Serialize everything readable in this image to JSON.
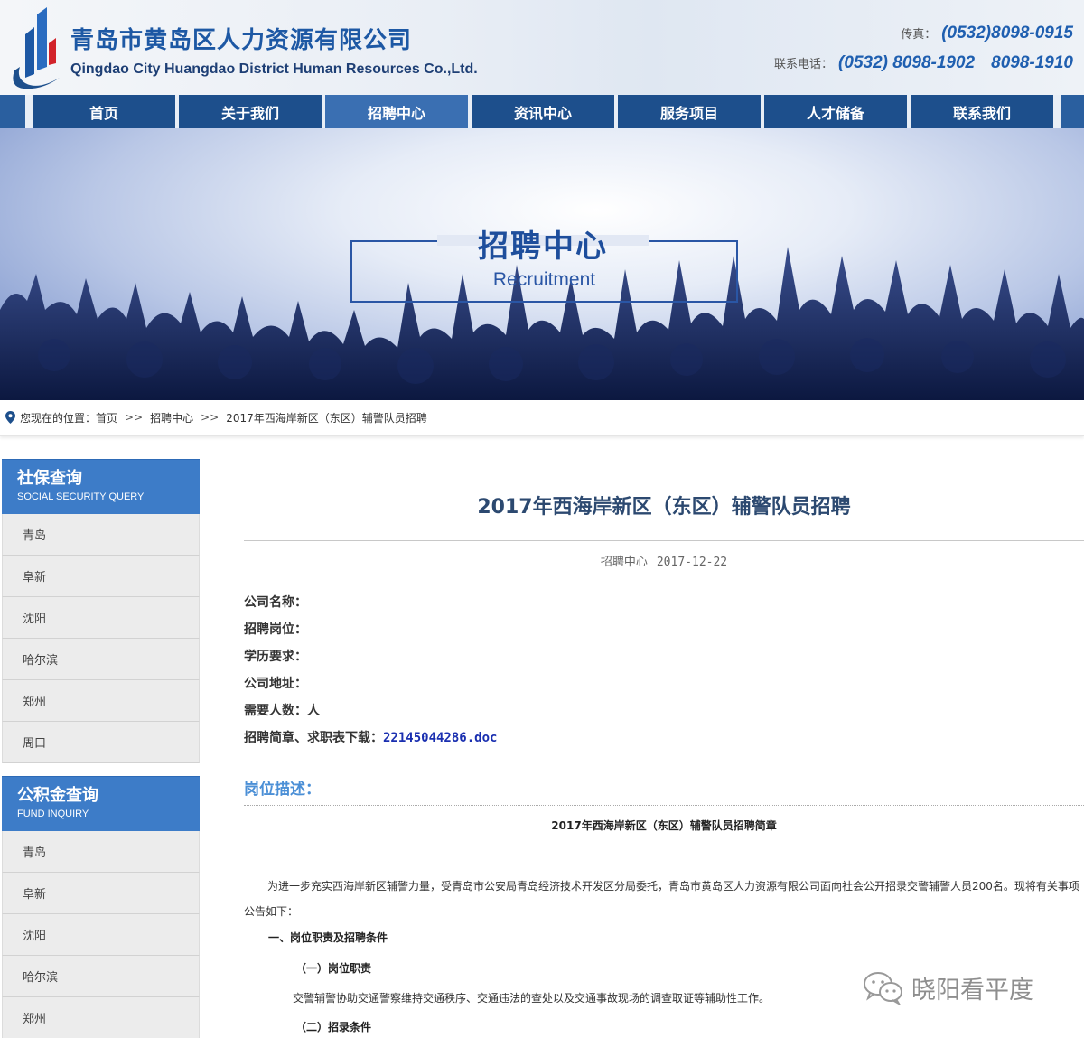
{
  "header": {
    "company_cn": "青岛市黄岛区人力资源有限公司",
    "company_en": "Qingdao City Huangdao District Human Resources Co.,Ltd.",
    "fax_label": "传真：",
    "fax_value": "(0532)8098-0915",
    "tel_label": "联系电话：",
    "tel_value_1": "(0532) 8098-1902",
    "tel_value_2": "8098-1910"
  },
  "nav": {
    "items": [
      {
        "label": "首页"
      },
      {
        "label": "关于我们"
      },
      {
        "label": "招聘中心"
      },
      {
        "label": "资讯中心"
      },
      {
        "label": "服务项目"
      },
      {
        "label": "人才储备"
      },
      {
        "label": "联系我们"
      }
    ],
    "active": "招聘中心"
  },
  "banner": {
    "title": "招聘中心",
    "subtitle": "Recruitment"
  },
  "breadcrumb": {
    "prefix": "您现在的位置：",
    "home": "首页",
    "sep": ">>",
    "section": "招聘中心",
    "current": "2017年西海岸新区（东区）辅警队员招聘"
  },
  "sidebar": {
    "social": {
      "title": "社保查询",
      "title_en": "SOCIAL SECURITY QUERY",
      "items": [
        "青岛",
        "阜新",
        "沈阳",
        "哈尔滨",
        "郑州",
        "周口"
      ]
    },
    "fund": {
      "title": "公积金查询",
      "title_en": "FUND INQUIRY",
      "items": [
        "青岛",
        "阜新",
        "沈阳",
        "哈尔滨",
        "郑州"
      ]
    }
  },
  "article": {
    "title": "2017年西海岸新区（东区）辅警队员招聘",
    "category": "招聘中心",
    "date": "2017-12-22",
    "fields": {
      "company": "公司名称：",
      "position": "招聘岗位：",
      "education": "学历要求：",
      "address": "公司地址：",
      "count": "需要人数：人",
      "download_label": "招聘简章、求职表下载：",
      "download_file": "22145044286.doc"
    },
    "section_title": "岗位描述：",
    "doc_title": "2017年西海岸新区（东区）辅警队员招聘简章",
    "intro": "为进一步充实西海岸新区辅警力量，受青岛市公安局青岛经济技术开发区分局委托，青岛市黄岛区人力资源有限公司面向社会公开招录交警辅警人员200名。现将有关事项公告如下：",
    "heading_1": "一、岗位职责及招聘条件",
    "heading_1_1": "（一）岗位职责",
    "duty_text": "交警辅警协助交通警察维持交通秩序、交通违法的查处以及交通事故现场的调查取证等辅助性工作。",
    "heading_1_2": "（二）招录条件"
  },
  "watermark": {
    "text": "晓阳看平度"
  },
  "colors": {
    "nav_bg": "#1d4f8c",
    "nav_active": "#3a6fb2",
    "brand_blue": "#1d58a4",
    "sidebar_head": "#3d7cc8",
    "section_title": "#4b8fd6",
    "link": "#1a2fb0"
  }
}
